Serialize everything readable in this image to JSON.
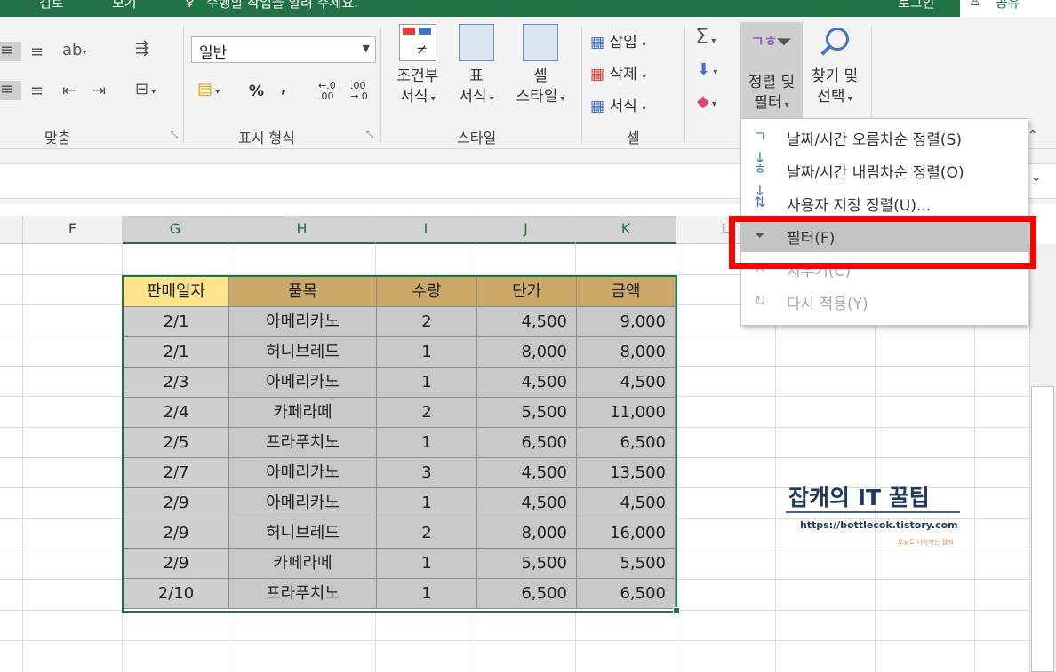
{
  "titlebar": {
    "tab_partial_1": "검토",
    "tab_partial_2": "보기",
    "tell_me": "수행할 작업을 알려 주세요.",
    "sign_in": "로그인",
    "share": "공유"
  },
  "ribbon": {
    "groups": {
      "alignment": "맞춤",
      "number": "표시 형식",
      "styles": "스타일",
      "cells": "셀"
    },
    "number_format": "일반",
    "percent": "%",
    "comma": ",",
    "inc_decimal_top": "←.0",
    "inc_decimal_bottom": ".00",
    "dec_decimal_top": ".00",
    "dec_decimal_bottom": "→.0",
    "conditional_format_1": "조건부",
    "conditional_format_2": "서식",
    "format_table_1": "표",
    "format_table_2": "서식",
    "cell_styles_1": "셀",
    "cell_styles_2": "스타일",
    "insert": "삽입",
    "delete": "삭제",
    "format": "서식",
    "sort_filter_1": "정렬 및",
    "sort_filter_2": "필터",
    "find_select_1": "찾기 및",
    "find_select_2": "선택"
  },
  "sort_menu": {
    "items": [
      {
        "label": "날짜/시간 오름차순 정렬(S)",
        "icon": "sort-ascending-icon",
        "state": "normal"
      },
      {
        "label": "날짜/시간 내림차순 정렬(O)",
        "icon": "sort-descending-icon",
        "state": "normal"
      },
      {
        "label": "사용자 지정 정렬(U)...",
        "icon": "custom-sort-icon",
        "state": "normal"
      },
      {
        "label": "필터(F)",
        "icon": "filter-icon",
        "state": "highlighted"
      },
      {
        "label": "지우기(C)",
        "icon": "clear-filter-icon",
        "state": "disabled"
      },
      {
        "label": "다시 적용(Y)",
        "icon": "reapply-icon",
        "state": "disabled"
      }
    ]
  },
  "columns": [
    "F",
    "G",
    "H",
    "I",
    "J",
    "K",
    "L"
  ],
  "table": {
    "headers": [
      "판매일자",
      "품목",
      "수량",
      "단가",
      "금액"
    ],
    "rows": [
      [
        "2/1",
        "아메리카노",
        "2",
        "4,500",
        "9,000"
      ],
      [
        "2/1",
        "허니브레드",
        "1",
        "8,000",
        "8,000"
      ],
      [
        "2/3",
        "아메리카노",
        "1",
        "4,500",
        "4,500"
      ],
      [
        "2/4",
        "카페라떼",
        "2",
        "5,500",
        "11,000"
      ],
      [
        "2/5",
        "프라푸치노",
        "1",
        "6,500",
        "6,500"
      ],
      [
        "2/7",
        "아메리카노",
        "3",
        "4,500",
        "13,500"
      ],
      [
        "2/9",
        "아메리카노",
        "1",
        "4,500",
        "4,500"
      ],
      [
        "2/9",
        "허니브레드",
        "2",
        "8,000",
        "16,000"
      ],
      [
        "2/9",
        "카페라떼",
        "1",
        "5,500",
        "5,500"
      ],
      [
        "2/10",
        "프라푸치노",
        "1",
        "6,500",
        "6,500"
      ]
    ]
  },
  "watermark": {
    "title": "잡캐의 IT 꿀팁",
    "url": "https://bottlecok.tistory.com",
    "small": "오늘도 나아가는 잡캐"
  },
  "colors": {
    "excel_green": "#217346",
    "header_gold": "#c9a86a",
    "header_first": "#fee38c",
    "body_gray": "#c8c8c8",
    "highlight_red": "#ff0000"
  }
}
